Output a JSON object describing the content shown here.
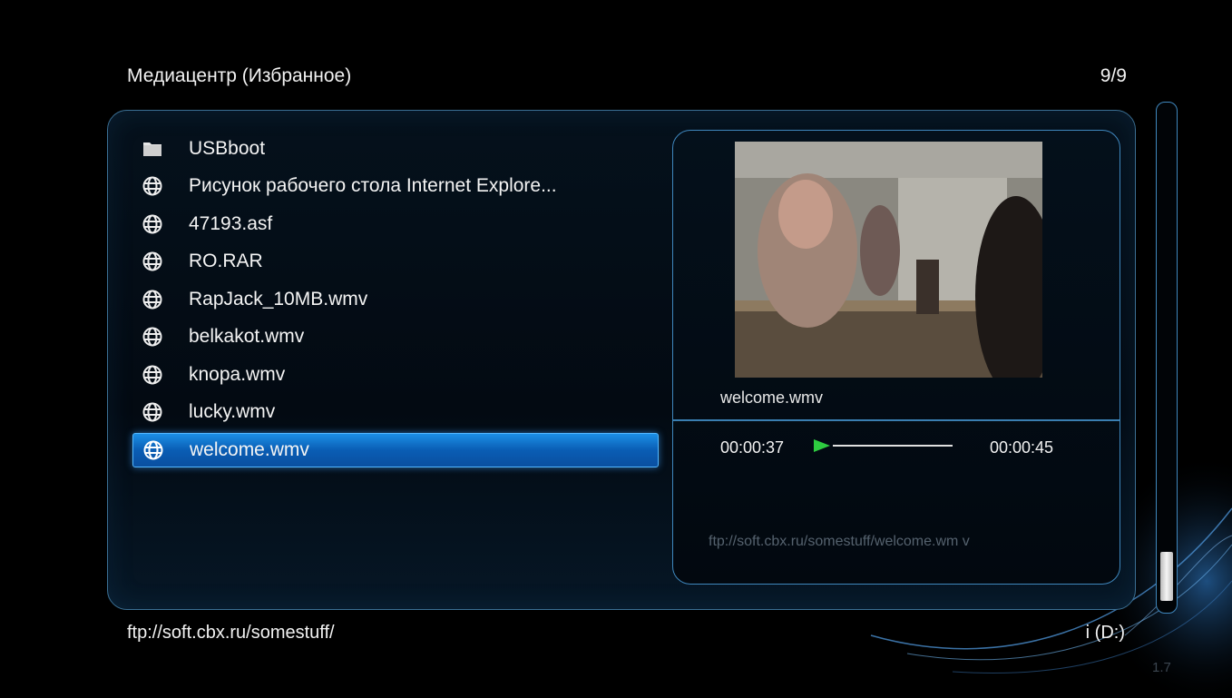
{
  "header": {
    "title": "Медиацентр (Избранное)",
    "counter": "9/9"
  },
  "file_list": {
    "items": [
      {
        "label": "USBboot",
        "icon": "folder-icon"
      },
      {
        "label": "Рисунок рабочего стола Internet Explore...",
        "icon": "globe-icon"
      },
      {
        "label": "47193.asf",
        "icon": "globe-icon"
      },
      {
        "label": "RO.RAR",
        "icon": "globe-icon"
      },
      {
        "label": "RapJack_10MB.wmv",
        "icon": "globe-icon"
      },
      {
        "label": "belkakot.wmv",
        "icon": "globe-icon"
      },
      {
        "label": "knopa.wmv",
        "icon": "globe-icon"
      },
      {
        "label": "lucky.wmv",
        "icon": "globe-icon"
      },
      {
        "label": "welcome.wmv",
        "icon": "globe-icon",
        "selected": true
      }
    ]
  },
  "preview": {
    "filename": "welcome.wmv",
    "time_current": "00:00:37",
    "time_total": "00:00:45",
    "progress": 0.0,
    "url": "ftp://soft.cbx.ru/somestuff/welcome.wm v"
  },
  "footer": {
    "path": "ftp://soft.cbx.ru/somestuff/",
    "drive": "i (D:)",
    "version": "1.7"
  },
  "colors": {
    "accent": "#1c8fe6",
    "border": "#3f87bd",
    "play": "#2ecc40"
  }
}
